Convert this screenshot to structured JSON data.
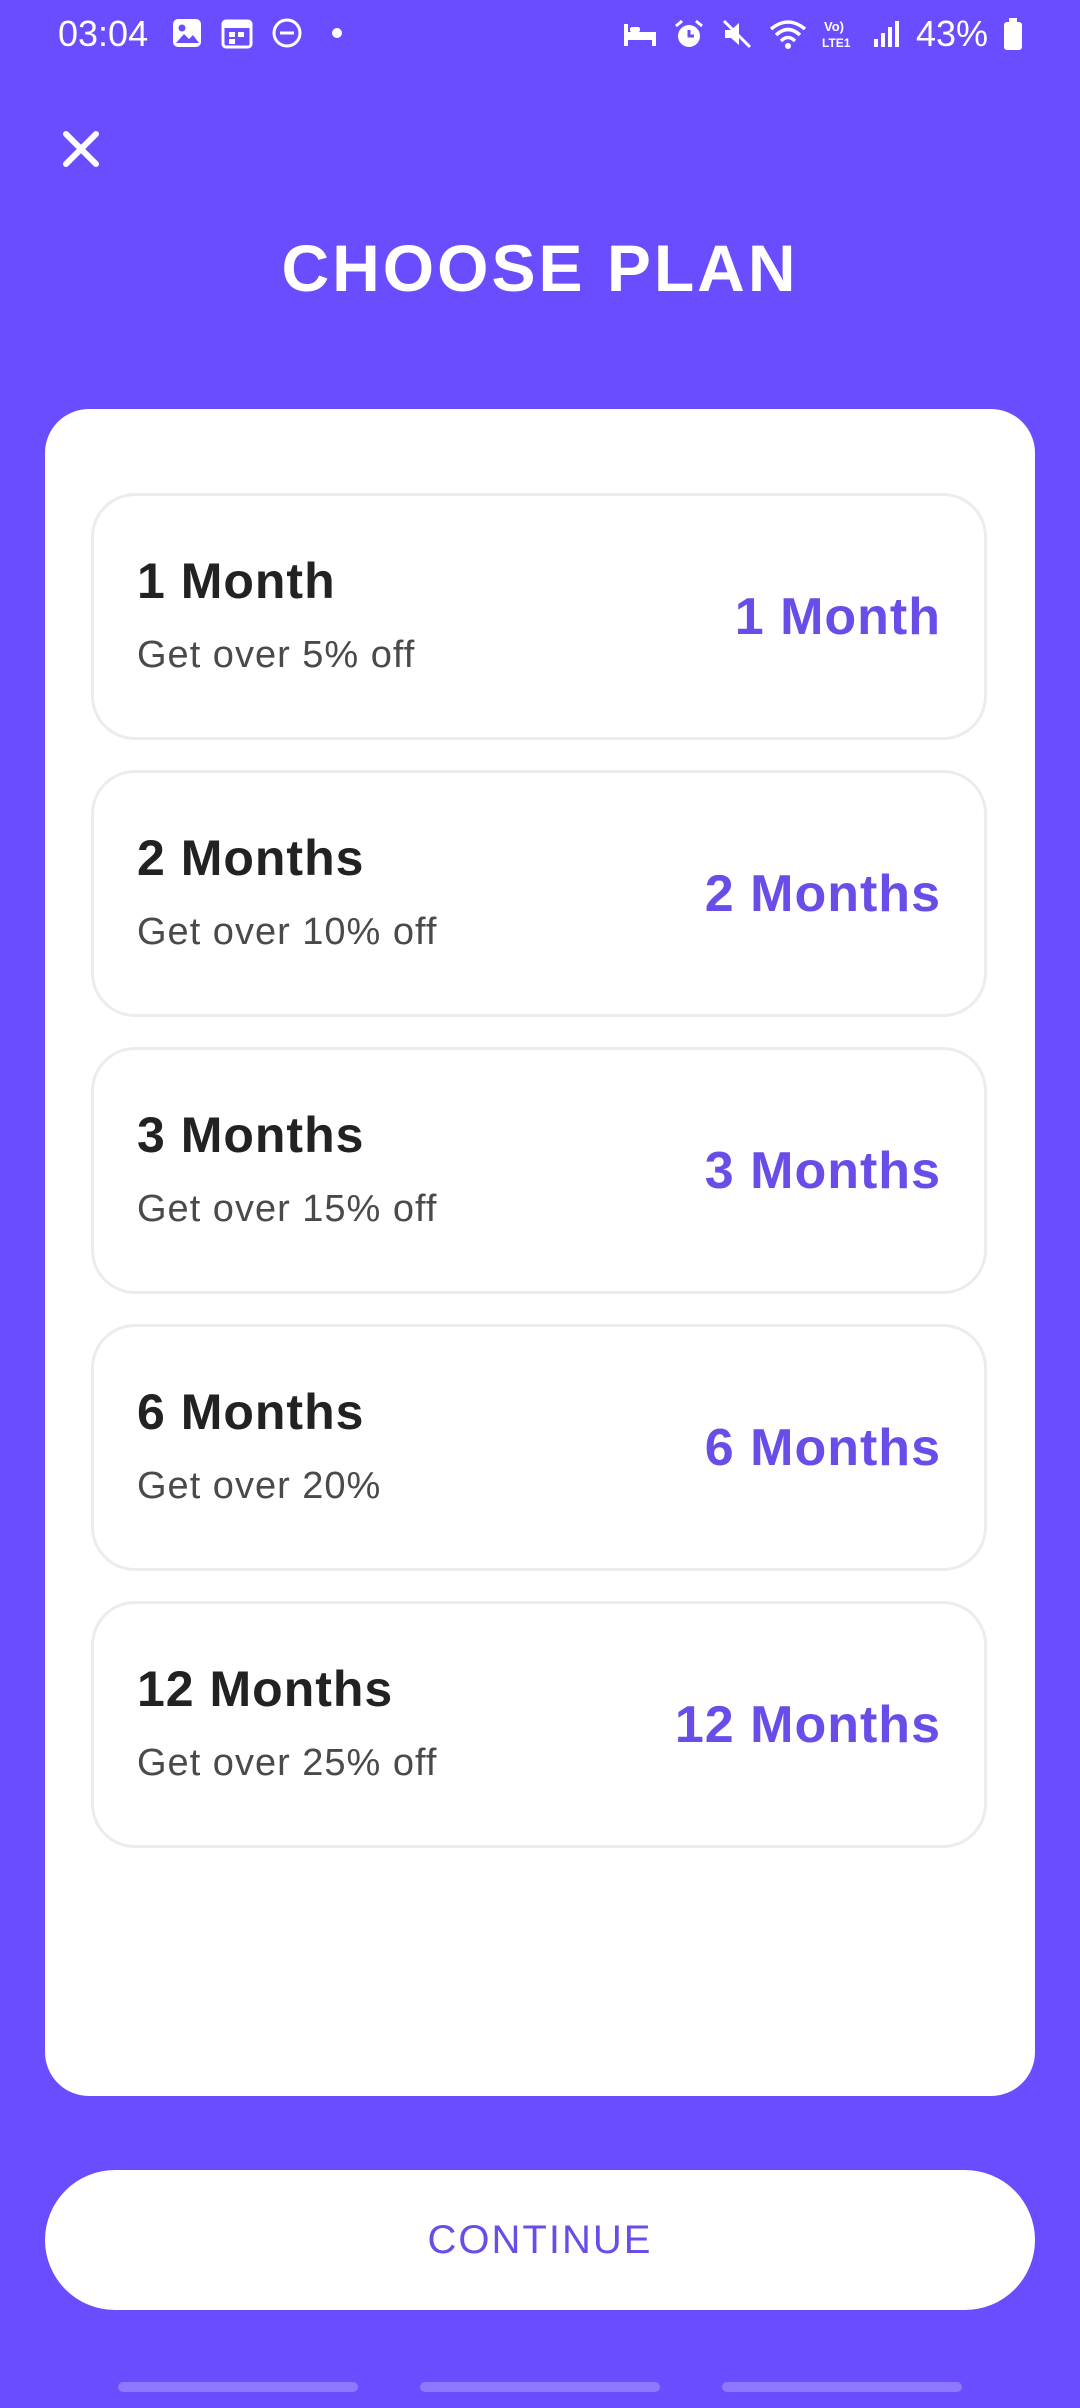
{
  "status_bar": {
    "time": "03:04",
    "battery": "43%",
    "left_icons": [
      "gallery-icon",
      "calendar-icon",
      "dnd-icon",
      "dot-icon"
    ],
    "right_icons": [
      "sleep-icon",
      "alarm-icon",
      "mute-icon",
      "wifi-icon",
      "volte-icon",
      "signal-icon",
      "battery-icon"
    ],
    "volte_label": "Vo) LTE1"
  },
  "header": {
    "close_icon": "close-icon",
    "title": "CHOOSE PLAN"
  },
  "plans": [
    {
      "name": "1 Month",
      "desc": "Get over 5% off",
      "value": "1 Month"
    },
    {
      "name": "2 Months",
      "desc": "Get over 10% off",
      "value": "2 Months"
    },
    {
      "name": "3 Months",
      "desc": "Get over 15% off",
      "value": "3 Months"
    },
    {
      "name": "6 Months",
      "desc": "Get over 20%",
      "value": "6 Months"
    },
    {
      "name": "12 Months",
      "desc": "Get over 25% off",
      "value": "12 Months"
    }
  ],
  "continue_label": "CONTINUE",
  "colors": {
    "background": "#6A4DFF",
    "accent": "#6A4DE8",
    "card": "#FFFFFF"
  }
}
